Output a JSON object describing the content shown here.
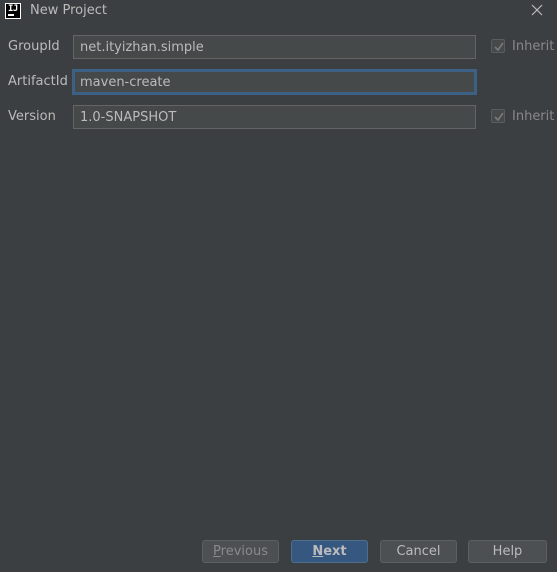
{
  "window": {
    "title": "New Project",
    "logo_text": "IJ"
  },
  "form": {
    "group_id": {
      "label": "GroupId",
      "value": "net.ityizhan.simple",
      "inherit_label": "Inherit",
      "inherit_checked": true
    },
    "artifact_id": {
      "label": "ArtifactId",
      "value": "maven-create"
    },
    "version": {
      "label": "Version",
      "value": "1.0-SNAPSHOT",
      "inherit_label": "Inherit",
      "inherit_checked": true
    }
  },
  "buttons": {
    "previous_mnemonic": "P",
    "previous_rest": "revious",
    "next_mnemonic": "N",
    "next_rest": "ext",
    "cancel": "Cancel",
    "help": "Help"
  },
  "colors": {
    "background": "#3c3f41",
    "field_background": "#45494a",
    "focus_border": "#3d6185",
    "default_button": "#365880",
    "text": "#bbbbbb"
  },
  "icons": {
    "logo": "intellij-logo-icon",
    "close": "close-icon",
    "check": "checkmark-icon"
  }
}
